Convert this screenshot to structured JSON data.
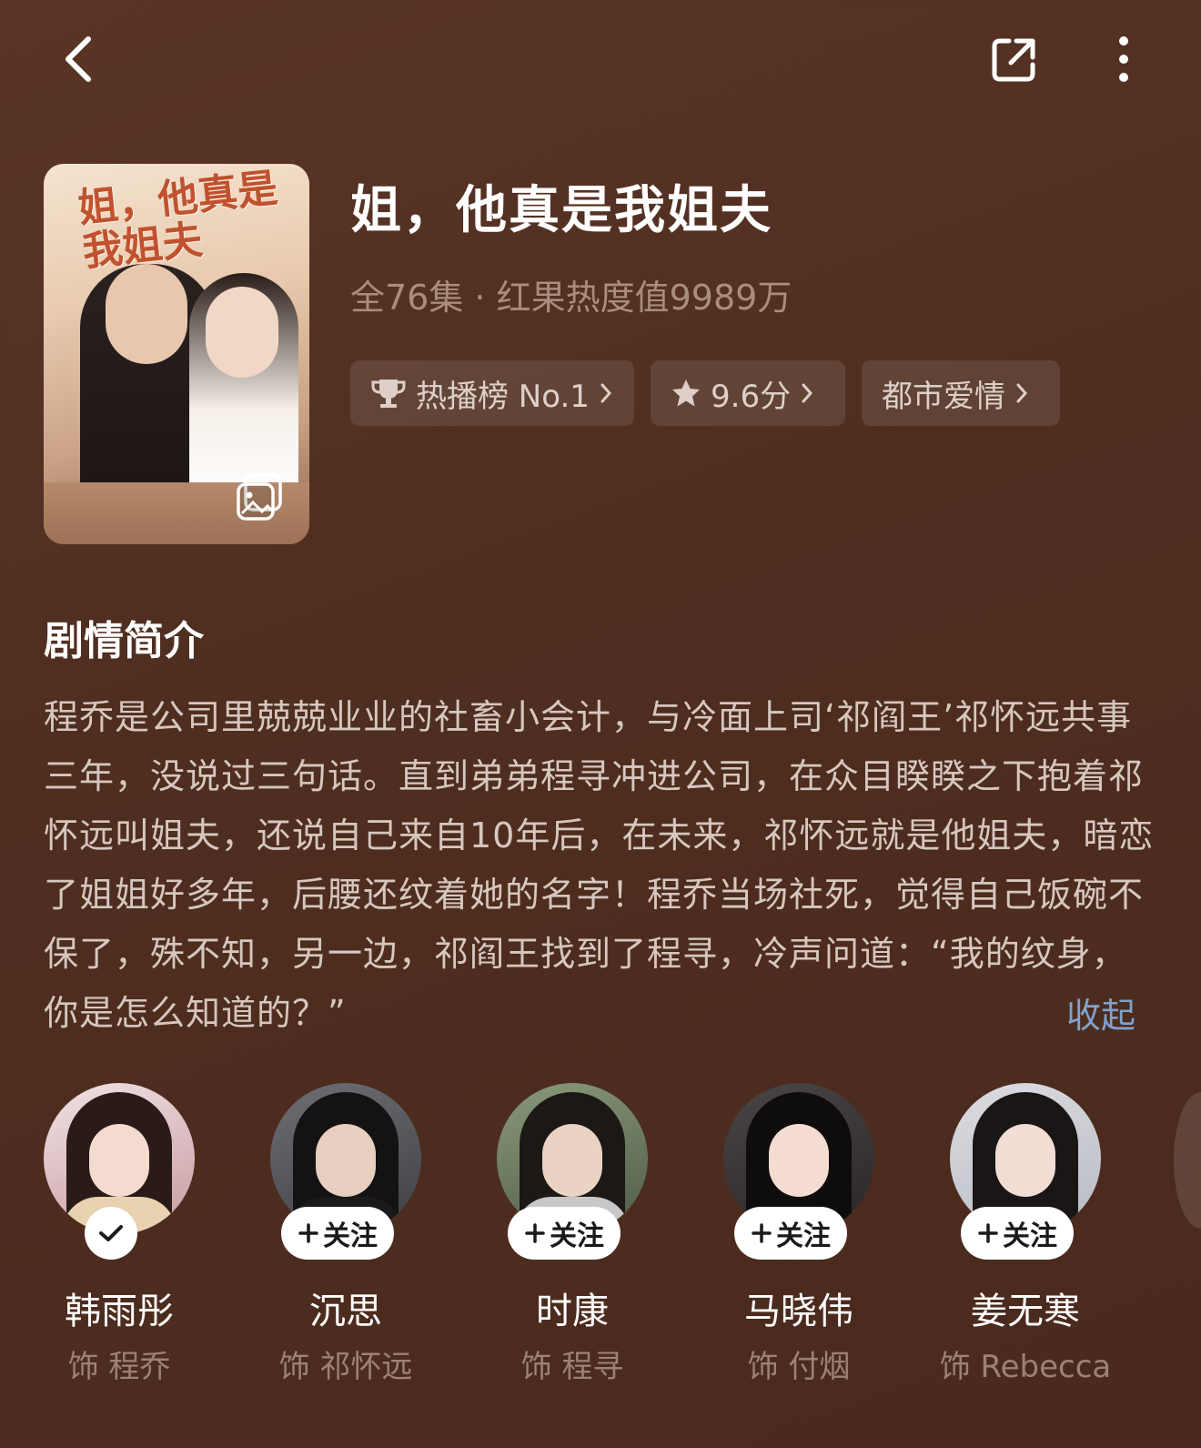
{
  "drama": {
    "title": "姐，他真是我姐夫",
    "meta": "全76集 · 红果热度值9989万",
    "poster_title": "姐，他真是我姐夫"
  },
  "tags": [
    {
      "label": "热播榜 No.1",
      "icon": "trophy-icon"
    },
    {
      "label": "9.6分",
      "icon": "star-icon"
    },
    {
      "label": "都市爱情",
      "icon": ""
    }
  ],
  "synopsis": {
    "heading": "剧情简介",
    "text": "程乔是公司里兢兢业业的社畜小会计，与冷面上司‘祁阎王’祁怀远共事三年，没说过三句话。直到弟弟程寻冲进公司，在众目睽睽之下抱着祁怀远叫姐夫，还说自己来自10年后，在未来，祁怀远就是他姐夫，暗恋了姐姐好多年，后腰还纹着她的名字！程乔当场社死，觉得自己饭碗不保了，殊不知，另一边，祁阎王找到了程寻，冷声问道：“我的纹身，你是怎么知道的？”",
    "collapse_label": "收起"
  },
  "follow_label": "关注",
  "cast": [
    {
      "name": "韩雨彤",
      "role": "饰 程乔",
      "followed": true
    },
    {
      "name": "沉思",
      "role": "饰 祁怀远",
      "followed": false
    },
    {
      "name": "时康",
      "role": "饰 程寻",
      "followed": false
    },
    {
      "name": "马晓伟",
      "role": "饰 付烟",
      "followed": false
    },
    {
      "name": "姜无寒",
      "role": "饰 Rebecca",
      "followed": false
    }
  ],
  "colors": {
    "background": "#4f2e20",
    "link": "#7fa2cf",
    "muted": "#a98d7f"
  },
  "icons": [
    "back-arrow-icon",
    "share-icon",
    "more-vertical-icon",
    "gallery-icon",
    "trophy-icon",
    "star-icon",
    "chevron-right-icon",
    "check-icon",
    "plus-icon"
  ]
}
